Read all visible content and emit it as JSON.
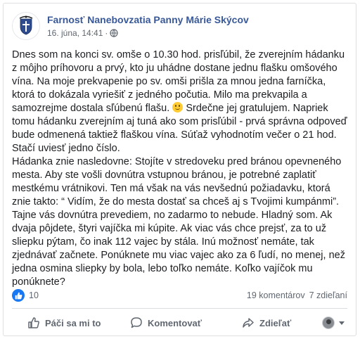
{
  "post": {
    "page_name": "Farnosť Nanebovzatia Panny Márie Skýcov",
    "date": "16. júna, 14:41",
    "separator": "·",
    "audience_icon": "globe-icon",
    "avatar_icon": "parish-crest-icon",
    "text": {
      "p1_a": "Dnes som na konci sv. omše o 10.30 hod. prisľúbil, že zverejním hádanku z môjho príhovoru a prvý, kto ju uhádne dostane jednu flašku omšového vína. Na moje prekvapenie po sv. omši prišla za mnou jedna farníčka, ktorá to dokázala vyriešiť z jedného počutia. Milo ma prekvapila a samozrejme dostala sľúbenú flašu. ",
      "emoji": "slightly-smiling-face",
      "p1_b": " Srdečne jej gratulujem. Napriek tomu hádanku zverejním aj tuná ako som prisľúbil - prvá správna odpoveď bude odmenená taktiež flaškou vína. Súťaž vyhodnotím večer o 21 hod. Stačí uviesť jedno číslo.",
      "p2": "Hádanka znie nasledovne: Stojíte v stredoveku pred bránou opevneného mesta. Aby ste vošli dovnútra vstupnou bránou, je potrebné zaplatiť mestkému vrátnikovi. Ten má však na vás nevšednú požiadavku, ktorá znie takto: “ Vidím, že do mesta dostať sa chceš aj s Tvojimi kumpánmi”. Tajne vás dovnútra prevediem, no zadarmo to nebude. Hladný som. Ak dvaja pôjdete, štyri vajíčka mi kúpite. Ak viac vás chce prejsť, za to už sliepku pýtam, čo inak 112 vajec by stála. Inú možnosť nemáte, tak zjednávať začnete. Ponúknete mu viac vajec ako za 6 ľudí, no menej, než jedna osmina sliepky by bola, lebo toľko nemáte. Koľko vajíčok mu ponúknete?"
    }
  },
  "stats": {
    "reaction_icon": "like-icon",
    "reaction_color": "#1877f2",
    "likes": "10",
    "comments": "19 komentárov",
    "shares": "7 zdieľaní"
  },
  "actions": {
    "like": {
      "label": "Páči sa mi to",
      "icon": "thumbs-up-icon"
    },
    "comment": {
      "label": "Komentovať",
      "icon": "comment-icon"
    },
    "share": {
      "label": "Zdieľať",
      "icon": "share-icon"
    }
  },
  "colors": {
    "link": "#385898",
    "meta": "#606770",
    "text": "#1c1e21",
    "divider": "#dadde1"
  }
}
